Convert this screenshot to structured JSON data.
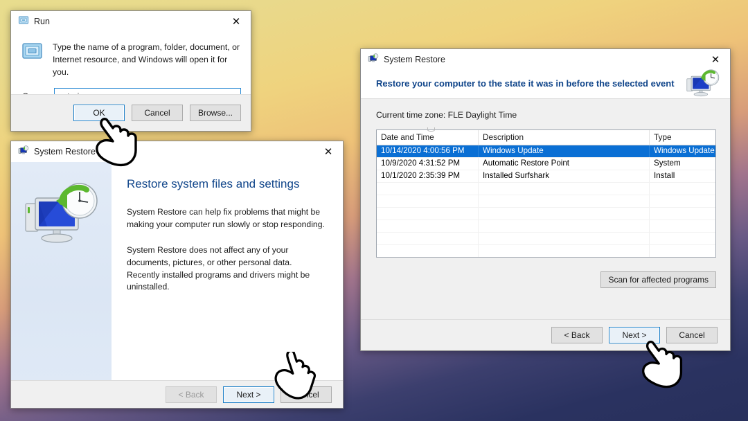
{
  "run_dialog": {
    "title": "Run",
    "icon": "run-app-icon",
    "close_label": "✕",
    "description": "Type the name of a program, folder, document, or Internet resource, and Windows will open it for you.",
    "open_label": "Open:",
    "open_value": "rstrui.exe",
    "open_placeholder": "",
    "buttons": {
      "ok": "OK",
      "cancel": "Cancel",
      "browse": "Browse..."
    }
  },
  "system_restore_intro": {
    "title": "System Restore",
    "icon": "system-restore-icon",
    "close_label": "✕",
    "heading": "Restore system files and settings",
    "paragraph1": "System Restore can help fix problems that might be making your computer run slowly or stop responding.",
    "paragraph2": "System Restore does not affect any of your documents, pictures, or other personal data. Recently installed programs and drivers might be uninstalled.",
    "buttons": {
      "back": "< Back",
      "next": "Next >",
      "cancel": "Cancel"
    }
  },
  "system_restore_points": {
    "title": "System Restore",
    "icon": "system-restore-icon",
    "close_label": "✕",
    "heading": "Restore your computer to the state it was in before the selected event",
    "time_zone": "Current time zone: FLE Daylight Time",
    "columns": [
      "Date and Time",
      "Description",
      "Type"
    ],
    "rows": [
      {
        "date_time": "10/14/2020 4:00:56 PM",
        "description": "Windows Update",
        "type": "Windows Update",
        "selected": true
      },
      {
        "date_time": "10/9/2020 4:31:52 PM",
        "description": "Automatic Restore Point",
        "type": "System",
        "selected": false
      },
      {
        "date_time": "10/1/2020 2:35:39 PM",
        "description": "Installed Surfshark",
        "type": "Install",
        "selected": false
      }
    ],
    "scan_button": "Scan for affected programs",
    "buttons": {
      "back": "< Back",
      "next": "Next >",
      "cancel": "Cancel"
    }
  },
  "colors": {
    "selection_blue": "#0a6fd4",
    "heading_blue": "#10458a",
    "focus_border": "#1a7ec8",
    "background_top": "#e8dd8e",
    "background_bottom": "#28305c"
  },
  "cursors": [
    {
      "name": "pointing-hand-over-ok"
    },
    {
      "name": "pointing-hand-over-next-intro"
    },
    {
      "name": "pointing-hand-over-next-points"
    }
  ]
}
